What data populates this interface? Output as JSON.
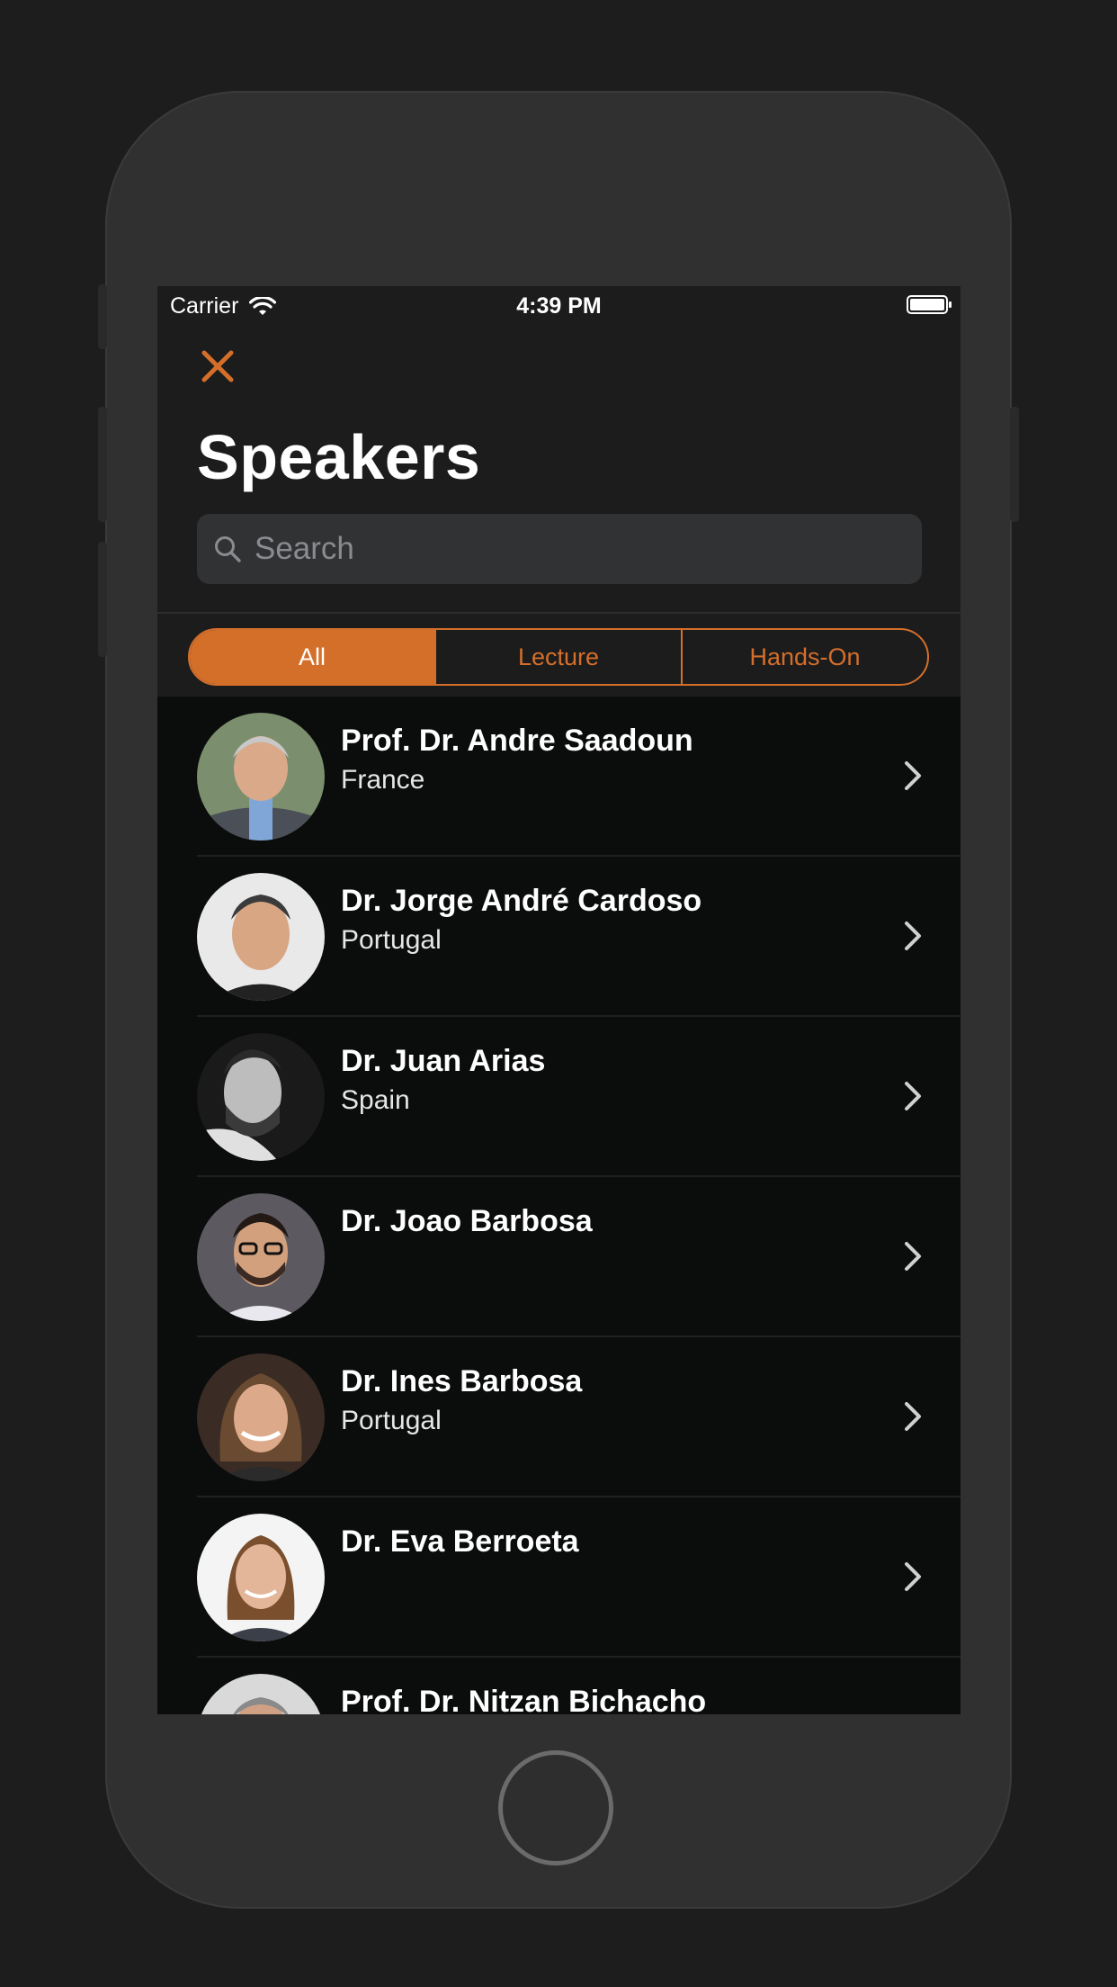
{
  "status_bar": {
    "carrier": "Carrier",
    "time": "4:39 PM"
  },
  "header": {
    "title": "Speakers",
    "close_icon": "close-icon"
  },
  "search": {
    "placeholder": "Search",
    "value": ""
  },
  "filter": {
    "segments": [
      "All",
      "Lecture",
      "Hands-On"
    ],
    "selected": "All"
  },
  "colors": {
    "accent": "#d46f2a",
    "background": "#1c1c1d",
    "list_background": "#0b0c0c"
  },
  "speakers": [
    {
      "name": "Prof. Dr. Andre Saadoun",
      "country": "France"
    },
    {
      "name": "Dr. Jorge André Cardoso",
      "country": "Portugal"
    },
    {
      "name": "Dr. Juan Arias",
      "country": "Spain"
    },
    {
      "name": "Dr. Joao Barbosa",
      "country": ""
    },
    {
      "name": "Dr. Ines Barbosa",
      "country": "Portugal"
    },
    {
      "name": "Dr. Eva Berroeta",
      "country": ""
    },
    {
      "name": "Prof. Dr. Nitzan Bichacho",
      "country": ""
    }
  ]
}
